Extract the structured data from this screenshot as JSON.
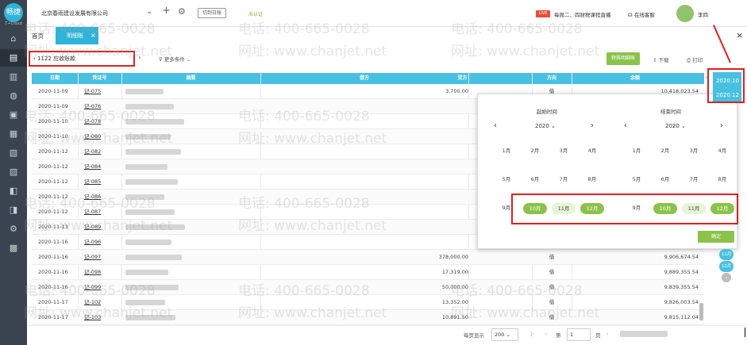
{
  "sidebar": {
    "logo": "畅捷",
    "logo_text": "T+Cloud",
    "icons": [
      "home-icon",
      "ledger-icon",
      "chart-icon",
      "bag-icon",
      "inventory-icon",
      "invoice-icon",
      "report-icon",
      "tax-icon",
      "assets-icon",
      "audit-icon",
      "settings-icon",
      "box-icon"
    ]
  },
  "topbar": {
    "company": "北京春雨建设发展有限公司",
    "switch_label": "切到日账",
    "cert": "未认证",
    "live_label": "LIVE",
    "live_text": "每周二、四财税课程直播",
    "service": "在线客服",
    "user": "李四"
  },
  "tabs": {
    "home": "首页",
    "active": "明细账",
    "active_close": "×"
  },
  "filter": {
    "account": "1122 应收账款",
    "more": "更多条件",
    "special_btn": "特殊明细账",
    "download": "下载",
    "print": "打印"
  },
  "table": {
    "columns": [
      "日期",
      "凭证号",
      "摘要",
      "借方",
      "贷方",
      "方向",
      "余额"
    ],
    "rows": [
      {
        "date": "2020-11-09",
        "voucher": "记-075",
        "credit": "3,700.00",
        "dir": "借",
        "balance": "10,418,023.54"
      },
      {
        "date": "2020-11-09",
        "voucher": "记-076",
        "credit": "",
        "dir": "",
        "balance": ""
      },
      {
        "date": "2020-11-10",
        "voucher": "记-078",
        "credit": "",
        "dir": "",
        "balance": ""
      },
      {
        "date": "2020-11-10",
        "voucher": "记-080",
        "credit": "",
        "dir": "",
        "balance": ""
      },
      {
        "date": "2020-11-12",
        "voucher": "记-082",
        "credit": "",
        "dir": "",
        "balance": ""
      },
      {
        "date": "2020-11-12",
        "voucher": "记-084",
        "credit": "",
        "dir": "",
        "balance": ""
      },
      {
        "date": "2020-11-12",
        "voucher": "记-085",
        "credit": "",
        "dir": "",
        "balance": ""
      },
      {
        "date": "2020-11-12",
        "voucher": "记-086",
        "credit": "",
        "dir": "",
        "balance": ""
      },
      {
        "date": "2020-11-12",
        "voucher": "记-087",
        "credit": "",
        "dir": "",
        "balance": ""
      },
      {
        "date": "2020-11-13",
        "voucher": "记-089",
        "credit": "",
        "dir": "",
        "balance": ""
      },
      {
        "date": "2020-11-16",
        "voucher": "记-096",
        "credit": "",
        "dir": "",
        "balance": ""
      },
      {
        "date": "2020-11-16",
        "voucher": "记-097",
        "credit": "378,000.00",
        "dir": "借",
        "balance": "9,906,674.54"
      },
      {
        "date": "2020-11-16",
        "voucher": "记-098",
        "credit": "17,319.00",
        "dir": "借",
        "balance": "9,889,355.54"
      },
      {
        "date": "2020-11-16",
        "voucher": "记-099",
        "credit": "50,000.00",
        "dir": "借",
        "balance": "9,839,355.54"
      },
      {
        "date": "2020-11-17",
        "voucher": "记-102",
        "credit": "13,352.00",
        "dir": "借",
        "balance": "9,826,003.54"
      },
      {
        "date": "2020-11-17",
        "voucher": "记-103",
        "credit": "10,891.50",
        "dir": "借",
        "balance": "9,815,112.04"
      }
    ]
  },
  "picker": {
    "start_title": "起始时间",
    "end_title": "结束时间",
    "year": "2020",
    "prev": "‹",
    "next": "›",
    "months": [
      "1月",
      "2月",
      "3月",
      "4月",
      "5月",
      "6月",
      "7月",
      "8月",
      "9月",
      "10月",
      "11月",
      "12月"
    ],
    "confirm": "确定"
  },
  "side": {
    "from": "2020.10",
    "to": "2020.12",
    "dot": "·",
    "mini1": "11月",
    "mini2": "12月",
    "collapse": "‹",
    "scroll": "⌄"
  },
  "footer": {
    "per_page_label": "每页显示",
    "per_page": "200",
    "first": "|‹",
    "prev": "‹",
    "page_label": "第",
    "page": "1",
    "page_suffix": "页",
    "next": "›",
    "last": "›|"
  },
  "watermark": {
    "phone": "电话: 400-665-0028",
    "site": "网址: www.chanjet.net"
  },
  "colors": {
    "accent": "#48c0e2",
    "green": "#8bc34a",
    "highlight": "#e02020"
  }
}
